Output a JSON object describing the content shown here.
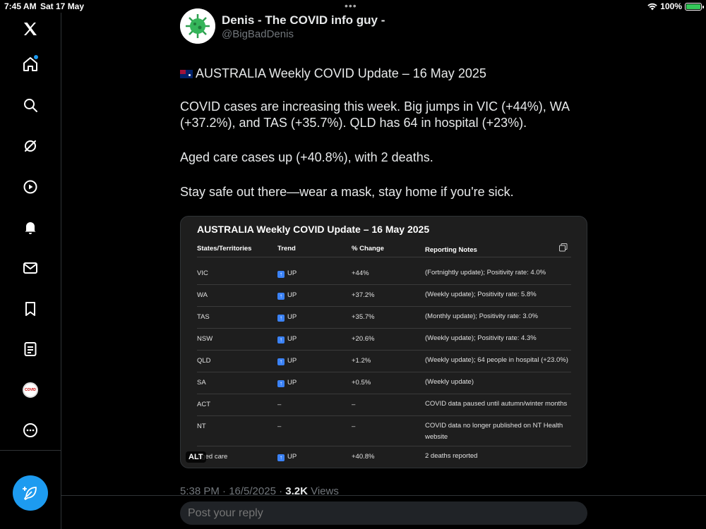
{
  "status": {
    "time": "7:45 AM",
    "date": "Sat 17 May",
    "dots": "•••",
    "battery": "100%"
  },
  "sidebar": {
    "items": [
      {
        "icon": "x-logo-icon"
      },
      {
        "icon": "home-icon"
      },
      {
        "icon": "search-icon"
      },
      {
        "icon": "grok-icon"
      },
      {
        "icon": "video-icon"
      },
      {
        "icon": "bell-icon"
      },
      {
        "icon": "mail-icon"
      },
      {
        "icon": "bookmark-icon"
      },
      {
        "icon": "lists-icon"
      },
      {
        "icon": "profile-avatar"
      },
      {
        "icon": "more-icon"
      }
    ]
  },
  "author": {
    "name": "Denis - The COVID info guy -",
    "handle": "@BigBadDenis"
  },
  "tweet": {
    "line1": "AUSTRALIA Weekly COVID Update – 16 May 2025",
    "para1": "COVID cases are increasing this week. Big jumps in VIC (+44%), WA (+37.2%), and TAS (+35.7%). QLD has 64 in hospital (+23%).",
    "para2": "Aged care cases up (+40.8%), with 2 deaths.",
    "para3": "Stay safe out there—wear a mask, stay home if you're sick."
  },
  "card": {
    "title": "AUSTRALIA Weekly COVID Update – 16 May 2025",
    "alt": "ALT",
    "headers": [
      "States/Territories",
      "Trend",
      "% Change",
      "Reporting Notes"
    ],
    "rows": [
      {
        "state": "VIC",
        "trend": "UP",
        "change": "+44%",
        "notes": "(Fortnightly update); Positivity rate: 4.0%"
      },
      {
        "state": "WA",
        "trend": "UP",
        "change": "+37.2%",
        "notes": "(Weekly update); Positivity rate: 5.8%"
      },
      {
        "state": "TAS",
        "trend": "UP",
        "change": "+35.7%",
        "notes": "(Monthly update); Positivity rate: 3.0%"
      },
      {
        "state": "NSW",
        "trend": "UP",
        "change": "+20.6%",
        "notes": "(Weekly update); Positivity rate: 4.3%"
      },
      {
        "state": "QLD",
        "trend": "UP",
        "change": "+1.2%",
        "notes": "(Weekly update); 64 people in hospital (+23.0%)"
      },
      {
        "state": "SA",
        "trend": "UP",
        "change": "+0.5%",
        "notes": "(Weekly update)"
      },
      {
        "state": "ACT",
        "trend": "–",
        "change": "–",
        "notes": "COVID data paused until autumn/winter months"
      },
      {
        "state": "NT",
        "trend": "–",
        "change": "–",
        "notes": "COVID data no longer published on NT Health website"
      },
      {
        "state": "Aged care",
        "trend": "UP",
        "change": "+40.8%",
        "notes": "2 deaths reported"
      }
    ]
  },
  "meta": {
    "time": "5:38 PM · 16/5/2025 · ",
    "views_count": "3.2K",
    "views_label": " Views"
  },
  "reply": {
    "placeholder": "Post your reply"
  }
}
